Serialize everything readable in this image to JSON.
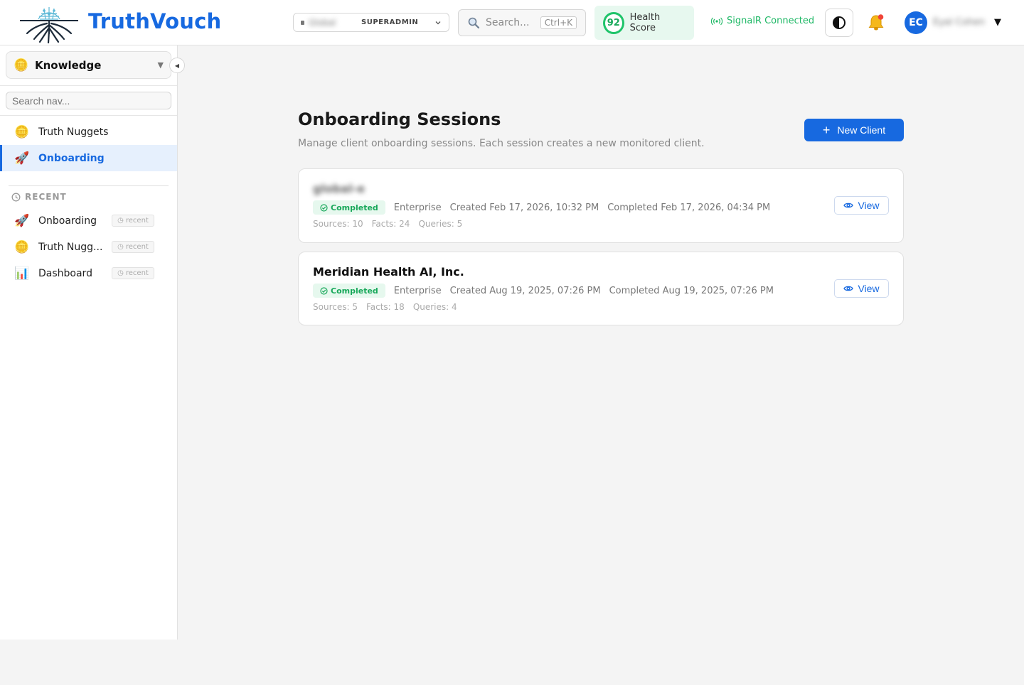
{
  "header": {
    "brand": "TruthVouch",
    "org": {
      "name": "Global",
      "role": "SUPERADMIN"
    },
    "search": {
      "placeholder": "Search...",
      "shortcut": "Ctrl+K"
    },
    "health": {
      "score": "92",
      "label": "Health Score"
    },
    "signal": "SignalR Connected",
    "user": {
      "initials": "EC",
      "name": "Eyal Cohen"
    }
  },
  "sidebar": {
    "section": "Knowledge",
    "search_placeholder": "Search nav...",
    "items": [
      {
        "label": "Truth Nuggets",
        "icon": "coin-icon",
        "active": false
      },
      {
        "label": "Onboarding",
        "icon": "rocket-icon",
        "active": true
      }
    ],
    "recent_heading": "RECENT",
    "recent": [
      {
        "label": "Onboarding",
        "icon": "rocket-icon",
        "tag": "recent"
      },
      {
        "label": "Truth Nugg...",
        "icon": "coin-icon",
        "tag": "recent"
      },
      {
        "label": "Dashboard",
        "icon": "bar-chart-icon",
        "tag": "recent"
      }
    ]
  },
  "main": {
    "title": "Onboarding Sessions",
    "subtitle": "Manage client onboarding sessions. Each session creates a new monitored client.",
    "new_client_label": "New Client",
    "sessions": [
      {
        "name": "global-e",
        "status": "Completed",
        "tier": "Enterprise",
        "created": "Created Feb 17, 2026, 10:32 PM",
        "completed": "Completed Feb 17, 2026, 04:34 PM",
        "sources": "Sources: 10",
        "facts": "Facts: 24",
        "queries": "Queries: 5",
        "view_label": "View"
      },
      {
        "name": "Meridian Health AI, Inc.",
        "status": "Completed",
        "tier": "Enterprise",
        "created": "Created Aug 19, 2025, 07:26 PM",
        "completed": "Completed Aug 19, 2025, 07:26 PM",
        "sources": "Sources: 5",
        "facts": "Facts: 18",
        "queries": "Queries: 4",
        "view_label": "View"
      }
    ]
  },
  "colors": {
    "brand": "#1769e0",
    "success": "#1fc46a",
    "active_bg": "#e6f0fd"
  }
}
